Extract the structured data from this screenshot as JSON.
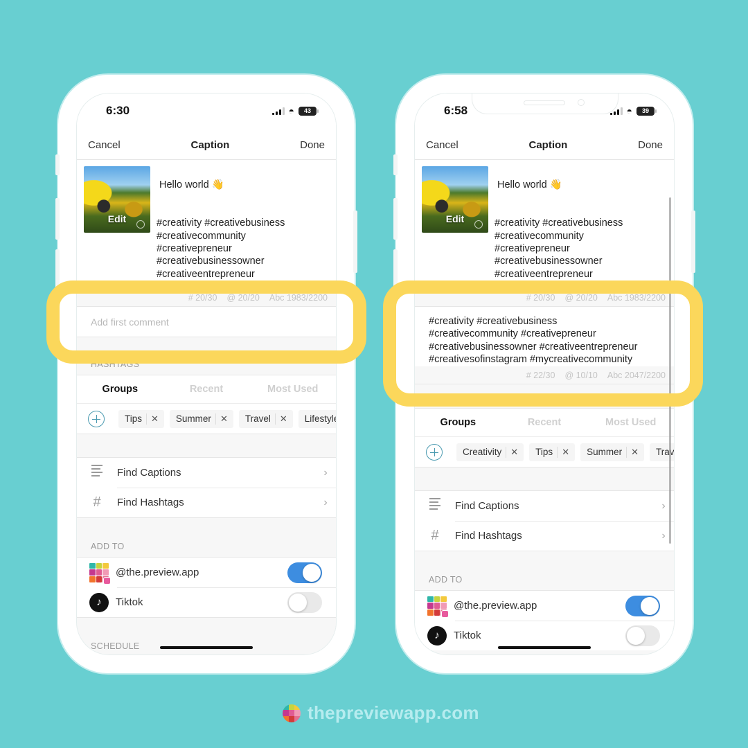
{
  "colors": {
    "background": "#68cfd1",
    "highlight": "#fbd75b",
    "toggle_on": "#3d8de0",
    "accent": "#4a9ab0"
  },
  "phones": [
    {
      "status": {
        "time": "6:30",
        "battery": "43"
      },
      "nav": {
        "cancel": "Cancel",
        "title": "Caption",
        "done": "Done"
      },
      "caption": {
        "thumb_edit_label": "Edit",
        "greeting": "Hello world 👋",
        "hashtags": "#creativity #creativebusiness\n#creativecommunity\n#creativepreneur\n#creativebusinessowner\n#creativeentrepreneur\n#creativesofinstagram\n#mycreativecommunity\n#wearethecreativecompany"
      },
      "counters": {
        "hashtags": "# 20/30",
        "mentions": "@ 20/20",
        "chars": "Abc 1983/2200"
      },
      "first_comment": {
        "placeholder": "Add first comment",
        "value": ""
      },
      "hashtags_section_label": "HASHTAGS",
      "tabs": [
        {
          "label": "Groups",
          "active": true
        },
        {
          "label": "Recent",
          "active": false
        },
        {
          "label": "Most Used",
          "active": false
        }
      ],
      "chips": [
        "Tips",
        "Summer",
        "Travel",
        "Lifestyle"
      ],
      "menu": [
        {
          "icon": "lines-icon",
          "label": "Find Captions"
        },
        {
          "icon": "hash-icon",
          "label": "Find Hashtags"
        }
      ],
      "add_to_label": "ADD TO",
      "accounts": [
        {
          "label": "@the.preview.app",
          "on": true
        },
        {
          "label": "Tiktok",
          "on": false
        }
      ],
      "schedule_label": "SCHEDULE"
    },
    {
      "status": {
        "time": "6:58",
        "battery": "39"
      },
      "nav": {
        "cancel": "Cancel",
        "title": "Caption",
        "done": "Done"
      },
      "caption": {
        "thumb_edit_label": "Edit",
        "greeting": "Hello world 👋",
        "hashtags": "#creativity #creativebusiness\n#creativecommunity\n#creativepreneur\n#creativebusinessowner\n#creativeentrepreneur\n#creativesofinstagram\n#mycreativecommunity\n#wearethecreativecompany"
      },
      "counters": {
        "hashtags": "# 20/30",
        "mentions": "@ 20/20",
        "chars": "Abc 1983/2200"
      },
      "first_comment": {
        "placeholder": "Add first comment",
        "value": "#creativity #creativebusiness\n#creativecommunity #creativepreneur\n#creativebusinessowner #creativeentrepreneur\n#creativesofinstagram #mycreativecommunity"
      },
      "comment_counters": {
        "hashtags": "# 22/30",
        "mentions": "@ 10/10",
        "chars": "Abc 2047/2200"
      },
      "tabs": [
        {
          "label": "Groups",
          "active": true
        },
        {
          "label": "Recent",
          "active": false
        },
        {
          "label": "Most Used",
          "active": false
        }
      ],
      "chips": [
        "Creativity",
        "Tips",
        "Summer",
        "Travel"
      ],
      "menu": [
        {
          "icon": "lines-icon",
          "label": "Find Captions"
        },
        {
          "icon": "hash-icon",
          "label": "Find Hashtags"
        }
      ],
      "add_to_label": "ADD TO",
      "accounts": [
        {
          "label": "@the.preview.app",
          "on": true
        },
        {
          "label": "Tiktok",
          "on": false
        }
      ]
    }
  ],
  "footer": {
    "brand": "thepreviewapp.com"
  }
}
